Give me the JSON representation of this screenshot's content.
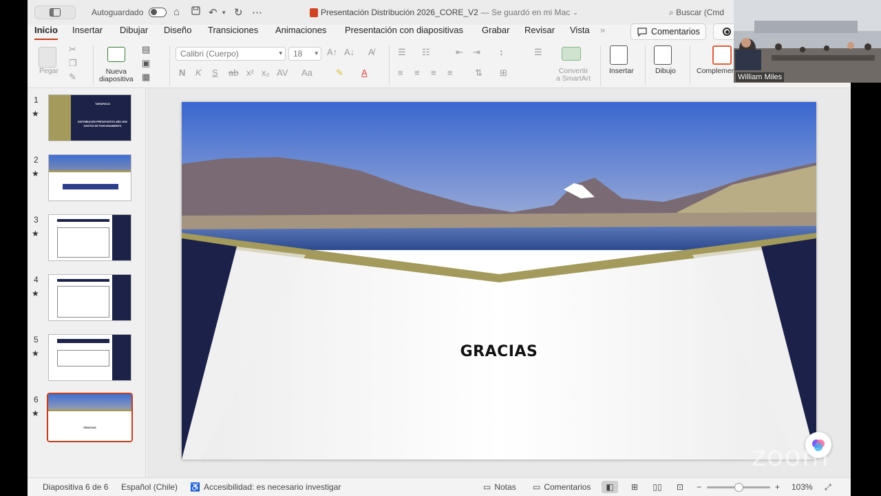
{
  "titlebar": {
    "autosave_label": "Autoguardado",
    "document_title": "Presentación Distribución 2026_CORE_V2",
    "saved_status": "— Se guardó en mi Mac",
    "search_placeholder": "Buscar (Cmd"
  },
  "tabs": [
    {
      "label": "Inicio",
      "active": true
    },
    {
      "label": "Insertar"
    },
    {
      "label": "Dibujar"
    },
    {
      "label": "Diseño"
    },
    {
      "label": "Transiciones"
    },
    {
      "label": "Animaciones"
    },
    {
      "label": "Presentación con diapositivas"
    },
    {
      "label": "Grabar"
    },
    {
      "label": "Revisar"
    },
    {
      "label": "Vista"
    }
  ],
  "tabs_more": "»",
  "comments_button": "Comentarios",
  "ribbon": {
    "paste": "Pegar",
    "new_slide": "Nueva\ndiapositiva",
    "font_name": "Calibri (Cuerpo)",
    "font_size": "18",
    "convert_smartart": "Convertir\na SmartArt",
    "insert": "Insertar",
    "drawing": "Dibujo",
    "addins": "Complemen"
  },
  "thumbnails": [
    {
      "number": "1",
      "caption_line1": "DISTRIBUCIÓN PRESUPUESTO AÑO 2026",
      "caption_line2": "GASTOS DE FUNCIONAMIENTO",
      "brand": "TARAPACÁ"
    },
    {
      "number": "2"
    },
    {
      "number": "3"
    },
    {
      "number": "4"
    },
    {
      "number": "5"
    },
    {
      "number": "6",
      "selected": true,
      "caption": "GRACIAS"
    }
  ],
  "slide": {
    "title": "GRACIAS"
  },
  "statusbar": {
    "slide_position": "Diapositiva 6 de 6",
    "language": "Español (Chile)",
    "accessibility": "Accesibilidad: es necesario investigar",
    "notes": "Notas",
    "comments": "Comentarios",
    "zoom_level": "103%",
    "zoom_minus": "−",
    "zoom_plus": "+"
  },
  "video": {
    "participant_name": "William Miles",
    "watermark": "zoom"
  },
  "colors": {
    "accent_red": "#c43e1c",
    "slide_navy": "#1b2148",
    "slide_gold": "#a39a5b",
    "sky_blue": "#3f6ed1"
  }
}
